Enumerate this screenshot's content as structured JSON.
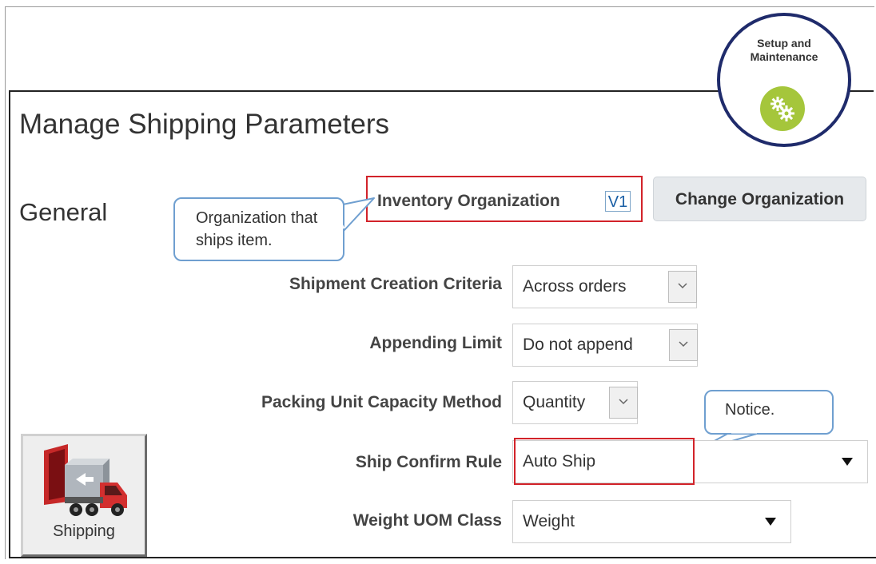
{
  "page": {
    "title": "Manage Shipping Parameters",
    "section": "General"
  },
  "badge": {
    "text": "Setup and\nMaintenance",
    "icon": "gears-icon",
    "ring_color": "#1f2b6b",
    "icon_bg": "#a5c63b"
  },
  "inventory": {
    "label": "Inventory Organization",
    "value": "V1",
    "change_button": "Change Organization"
  },
  "callouts": {
    "org": "Organization that ships item.",
    "notice": "Notice."
  },
  "fields": {
    "shipment_creation": {
      "label": "Shipment Creation Criteria",
      "value": "Across orders"
    },
    "appending_limit": {
      "label": "Appending Limit",
      "value": "Do not append"
    },
    "packing_unit": {
      "label": "Packing Unit Capacity Method",
      "value": "Quantity"
    },
    "ship_confirm": {
      "label": "Ship Confirm Rule",
      "value": "Auto Ship"
    },
    "weight_uom": {
      "label": "Weight UOM Class",
      "value": "Weight"
    }
  },
  "shipping_tile": {
    "label": "Shipping",
    "icon": "truck-icon"
  },
  "colors": {
    "highlight": "#d2232a",
    "callout_border": "#6f9fd0"
  }
}
